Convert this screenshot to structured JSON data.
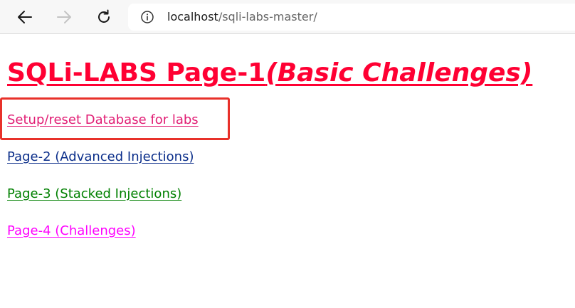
{
  "browser": {
    "url_host": "localhost",
    "url_path": "/sqli-labs-master/",
    "icons": {
      "back": "back-arrow-icon",
      "forward": "forward-arrow-icon",
      "refresh": "refresh-icon",
      "info": "info-icon"
    }
  },
  "page": {
    "title_main": "SQLi-LABS Page-1",
    "title_sub": "(Basic Challenges)",
    "title_color": "#ff0033",
    "links": [
      {
        "label": "Setup/reset Database for labs",
        "color": "#e11d74"
      },
      {
        "label": "Page-2 (Advanced Injections)",
        "color": "#0b2e8a"
      },
      {
        "label": "Page-3 (Stacked Injections)",
        "color": "#008000"
      },
      {
        "label": "Page-4 (Challenges)",
        "color": "#ff00ff"
      }
    ],
    "highlight_color": "#e8312a"
  }
}
